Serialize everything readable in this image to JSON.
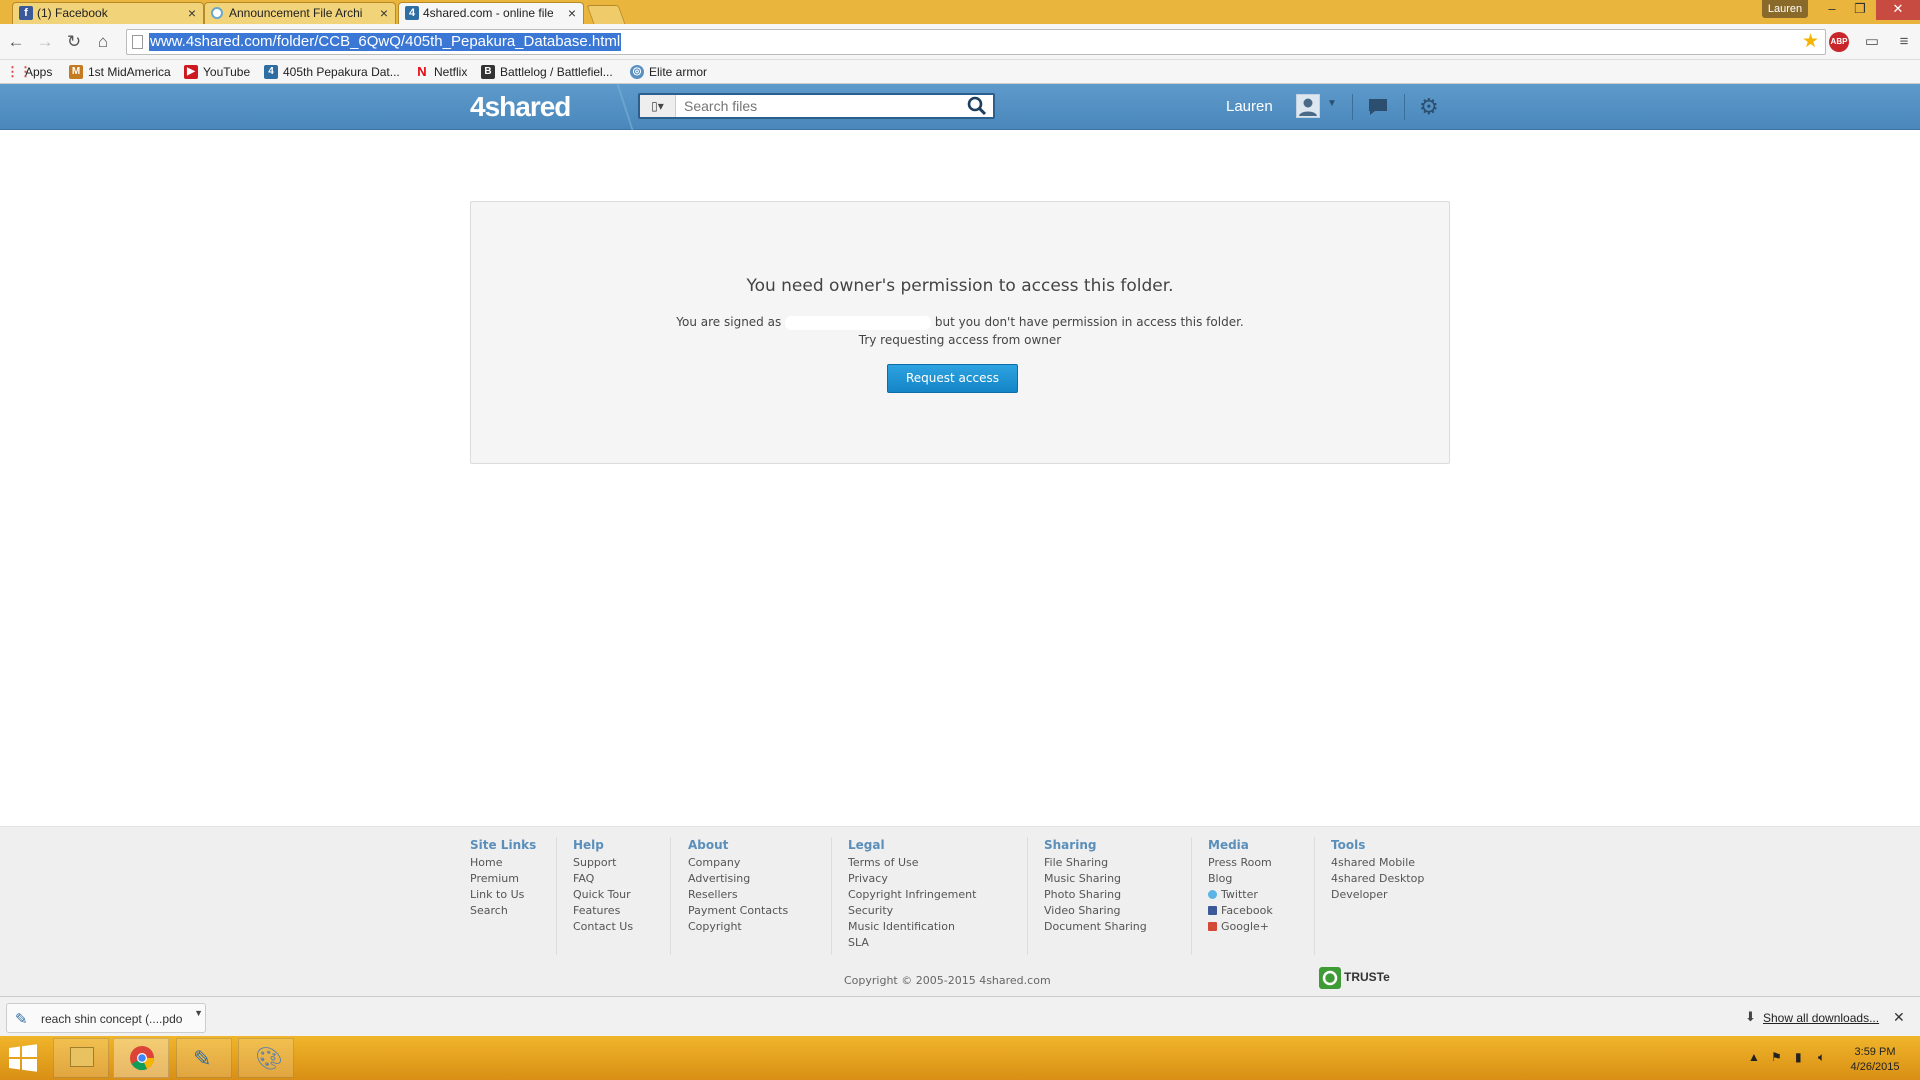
{
  "browser": {
    "tabs": [
      {
        "title": "(1) Facebook",
        "icon": "facebook-icon",
        "color": "#3b5998"
      },
      {
        "title": "Announcement File Archi",
        "icon": "chrome-page-icon",
        "color": "#6aa9c9"
      },
      {
        "title": "4shared.com - online file",
        "icon": "4shared-icon",
        "color": "#2f6ea3"
      }
    ],
    "profile_name": "Lauren",
    "url": "www.4shared.com/folder/CCB_6QwQ/405th_Pepakura_Database.html",
    "bookmarks": [
      {
        "label": "Apps",
        "icon": "apps-grid-icon",
        "color": "#d44"
      },
      {
        "label": "1st MidAmerica",
        "icon": "bookmark-favicon-icon",
        "color": "#c47a20"
      },
      {
        "label": "YouTube",
        "icon": "youtube-icon",
        "color": "#cc181e"
      },
      {
        "label": "405th Pepakura Dat...",
        "icon": "4shared-icon",
        "color": "#2f6ea3"
      },
      {
        "label": "Netflix",
        "icon": "netflix-icon",
        "color": "#e50914"
      },
      {
        "label": "Battlelog / Battlefiel...",
        "icon": "battlelog-icon",
        "color": "#333"
      },
      {
        "label": "Elite armor",
        "icon": "globe-icon",
        "color": "#5a8fc2"
      }
    ]
  },
  "site": {
    "logo": "4shared",
    "search_placeholder": "Search files",
    "username": "Lauren"
  },
  "permission": {
    "title": "You need owner's permission to access this folder.",
    "signed_as_prefix": "You are signed as",
    "signed_as_suffix": "but you don't have permission in access this folder.",
    "hint": "Try requesting access from owner",
    "button": "Request access"
  },
  "footer": {
    "columns": [
      {
        "heading": "Site Links",
        "links": [
          "Home",
          "Premium",
          "Link to Us",
          "Search"
        ]
      },
      {
        "heading": "Help",
        "links": [
          "Support",
          "FAQ",
          "Quick Tour",
          "Features",
          "Contact Us"
        ]
      },
      {
        "heading": "About",
        "links": [
          "Company",
          "Advertising",
          "Resellers",
          "Payment Contacts",
          "Copyright"
        ]
      },
      {
        "heading": "Legal",
        "links": [
          "Terms of Use",
          "Privacy",
          "Copyright Infringement",
          "Security",
          "Music Identification",
          "SLA"
        ]
      },
      {
        "heading": "Sharing",
        "links": [
          "File Sharing",
          "Music Sharing",
          "Photo Sharing",
          "Video Sharing",
          "Document Sharing"
        ]
      },
      {
        "heading": "Media",
        "links": [
          "Press Room",
          "Blog",
          "Twitter",
          "Facebook",
          "Google+"
        ]
      },
      {
        "heading": "Tools",
        "links": [
          "4shared Mobile",
          "4shared Desktop",
          "Developer"
        ]
      }
    ],
    "copyright": "Copyright © 2005-2015 4shared.com",
    "truste": "TRUSTe"
  },
  "downloads": {
    "item": "reach shin concept (....pdo",
    "show_all": "Show all downloads..."
  },
  "taskbar": {
    "time": "3:59 PM",
    "date": "4/26/2015"
  }
}
